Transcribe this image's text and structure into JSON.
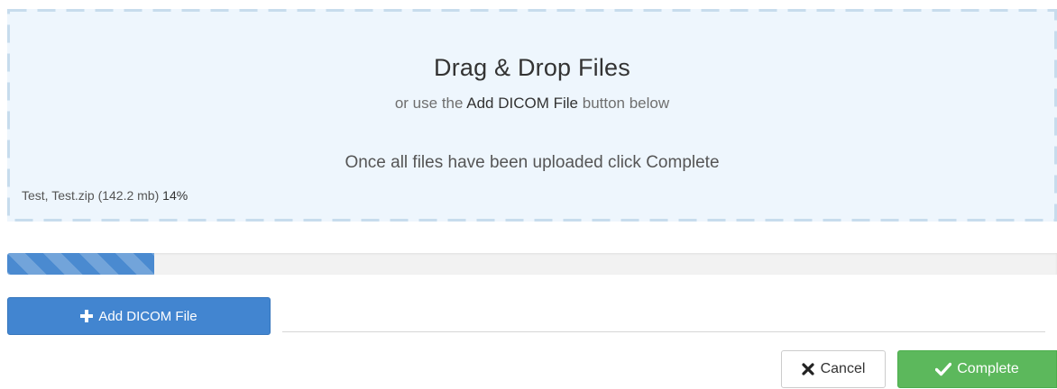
{
  "dropzone": {
    "title": "Drag & Drop Files",
    "subtitle_prefix": "or use the",
    "subtitle_button_name": "Add DICOM File",
    "subtitle_suffix": "button below",
    "instruction": "Once all files have been uploaded click Complete",
    "file_entry": {
      "name": "Test, Test.zip",
      "size": "(142.2 mb)",
      "percent_label": "14%"
    }
  },
  "upload_progress": {
    "percent": 14,
    "color": "#4a8ad0"
  },
  "buttons": {
    "add_dicom": {
      "label": "Add DICOM File",
      "icon": "plus-icon",
      "color": "#4285d0"
    },
    "cancel": {
      "label": "Cancel",
      "icon": "close-icon"
    },
    "complete": {
      "label": "Complete",
      "icon": "check-icon",
      "color": "#5cb85c"
    }
  }
}
